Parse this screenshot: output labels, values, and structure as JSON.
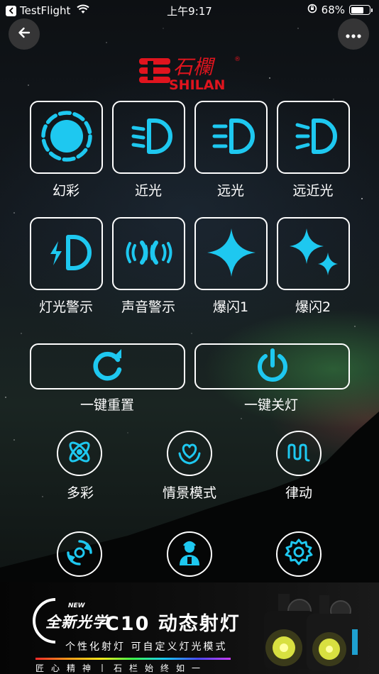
{
  "status_bar": {
    "back_app": "TestFlight",
    "time": "上午9:17",
    "battery": "68%",
    "battery_level": 0.68
  },
  "nav": {
    "back_icon": "arrow-left-icon",
    "more_icon": "ellipsis-icon"
  },
  "brand": {
    "chinese": "石欄",
    "latin": "SHILAN",
    "registered": "®",
    "color": "#e0141e"
  },
  "accent_color": "#1ec8f0",
  "tiles_row1": [
    {
      "label": "幻彩",
      "icon": "sun-icon"
    },
    {
      "label": "近光",
      "icon": "low-beam-icon"
    },
    {
      "label": "远光",
      "icon": "high-beam-icon"
    },
    {
      "label": "远近光",
      "icon": "high-low-beam-icon"
    }
  ],
  "tiles_row2": [
    {
      "label": "灯光警示",
      "icon": "light-warning-icon"
    },
    {
      "label": "声音警示",
      "icon": "sound-warning-icon"
    },
    {
      "label": "爆闪1",
      "icon": "sparkle-icon"
    },
    {
      "label": "爆闪2",
      "icon": "double-sparkle-icon"
    }
  ],
  "actions": [
    {
      "label": "一键重置",
      "icon": "reset-icon"
    },
    {
      "label": "一键关灯",
      "icon": "power-icon"
    }
  ],
  "modes": [
    {
      "label": "多彩",
      "icon": "atom-icon"
    },
    {
      "label": "情景模式",
      "icon": "heart-hands-icon"
    },
    {
      "label": "律动",
      "icon": "rhythm-icon"
    }
  ],
  "bottom_row": [
    {
      "icon": "rotate-cycle-icon"
    },
    {
      "icon": "person-support-icon"
    },
    {
      "icon": "settings-gear-icon"
    }
  ],
  "banner": {
    "new_tag": "NEW",
    "headline_1": "全新光学",
    "headline_2": "C10 动态射灯",
    "subtitle": "个性化射灯  可自定义灯光模式",
    "motto": "匠心精神丨石栏始终如一"
  }
}
